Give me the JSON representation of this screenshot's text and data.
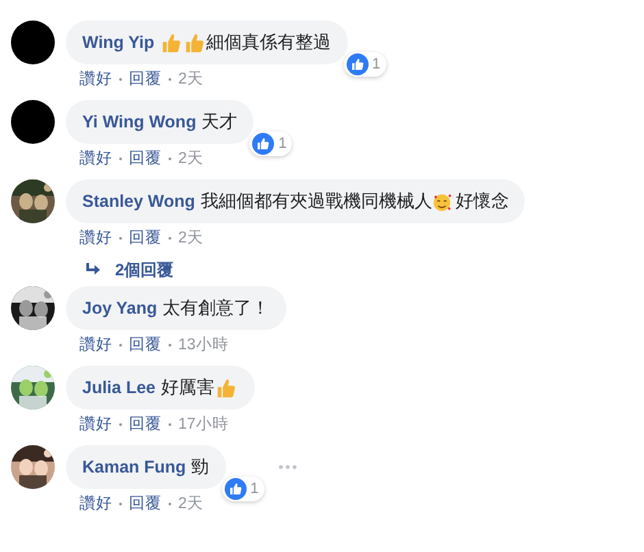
{
  "comments": [
    {
      "author": "Wing Yip",
      "avatar": {
        "kind": "plain"
      },
      "parts": [
        {
          "kind": "thumb"
        },
        {
          "kind": "thumb"
        },
        {
          "kind": "text",
          "text": "細個真係有整過"
        }
      ],
      "reaction": {
        "count": "1"
      },
      "actions": [
        "讚好",
        "回覆"
      ],
      "time": "2天",
      "menu_visible": false
    },
    {
      "author": "Yi Wing Wong",
      "avatar": {
        "kind": "plain"
      },
      "parts": [
        {
          "kind": "text",
          "text": "天才"
        }
      ],
      "reaction": {
        "count": "1"
      },
      "actions": [
        "讚好",
        "回覆"
      ],
      "time": "2天",
      "menu_visible": false
    },
    {
      "author": "Stanley Wong",
      "avatar": {
        "kind": "picture"
      },
      "parts": [
        {
          "kind": "text",
          "text": "我細個都有夾過戰機同機械人"
        },
        {
          "kind": "hearts"
        },
        {
          "kind": "text",
          "text": "好懷念"
        }
      ],
      "actions": [
        "讚好",
        "回覆"
      ],
      "time": "2天",
      "replies": "2個回覆",
      "menu_visible": false
    },
    {
      "author": "Joy Yang",
      "avatar": {
        "kind": "picture"
      },
      "parts": [
        {
          "kind": "text",
          "text": "太有創意了！"
        }
      ],
      "actions": [
        "讚好",
        "回覆"
      ],
      "time": "13小時",
      "menu_visible": false
    },
    {
      "author": "Julia Lee",
      "avatar": {
        "kind": "picture"
      },
      "parts": [
        {
          "kind": "text",
          "text": "好厲害"
        },
        {
          "kind": "thumb"
        }
      ],
      "actions": [
        "讚好",
        "回覆"
      ],
      "time": "17小時",
      "menu_visible": false
    },
    {
      "author": "Kaman Fung",
      "avatar": {
        "kind": "picture"
      },
      "parts": [
        {
          "kind": "text",
          "text": "勁"
        }
      ],
      "reaction": {
        "count": "1"
      },
      "actions": [
        "讚好",
        "回覆"
      ],
      "time": "2天",
      "menu_visible": true
    }
  ]
}
